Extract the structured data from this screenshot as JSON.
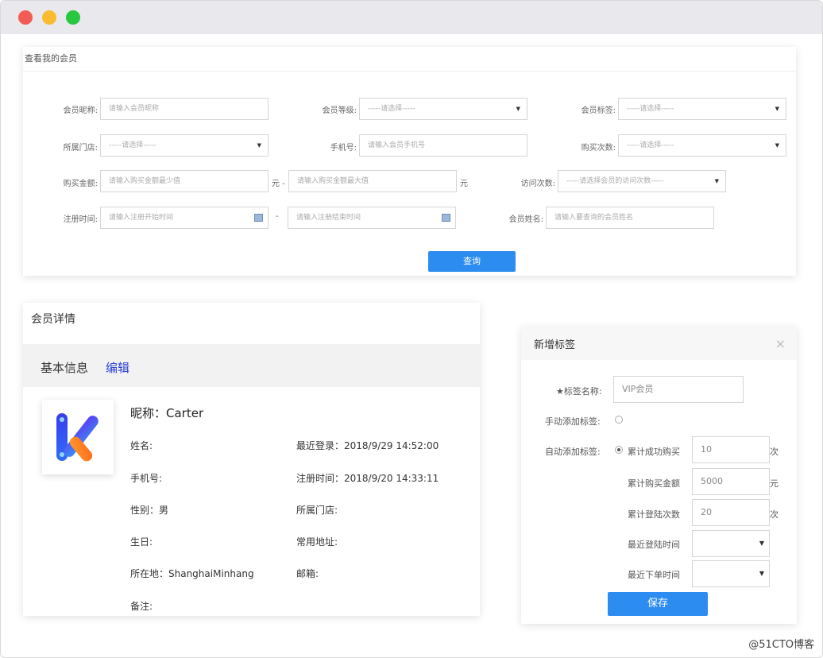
{
  "search": {
    "title": "查看我的会员",
    "nickname_label": "会员昵称:",
    "nickname_placeholder": "请输入会员昵称",
    "level_label": "会员等级:",
    "level_value": "-----请选择-----",
    "tag_label": "会员标签:",
    "tag_value": "-----请选择-----",
    "store_label": "所属门店:",
    "store_value": "-----请选择-----",
    "phone_label": "手机号:",
    "phone_placeholder": "请输入会员手机号",
    "purchase_count_label": "购买次数:",
    "purchase_count_value": "-----请选择-----",
    "amount_label": "购买金额:",
    "amount_min_placeholder": "请输入购买金额最少值",
    "amount_sep": "元 -",
    "amount_max_placeholder": "请输入购买金额最大值",
    "amount_unit": "元",
    "visit_label": "访问次数:",
    "visit_value": "-----请选择会员的访问次数-----",
    "reg_label": "注册时间:",
    "reg_start_placeholder": "请输入注册开始时间",
    "reg_sep": "-",
    "reg_end_placeholder": "请输入注册结束时间",
    "name_label": "会员姓名:",
    "name_placeholder": "请输入要查询的会员姓名",
    "query_button": "查询"
  },
  "detail": {
    "title": "会员详情",
    "basic_info": "基本信息",
    "edit": "编辑",
    "nickname": "昵称：Carter",
    "name": "姓名:",
    "last_login": "最近登录：2018/9/29 14:52:00",
    "phone": "手机号:",
    "reg_time": "注册时间：2018/9/20 14:33:11",
    "gender": "性别：男",
    "store": "所属门店:",
    "birthday": "生日:",
    "address": "常用地址:",
    "location": "所在地：ShanghaiMinhang",
    "email": "邮箱:",
    "remark": "备注:"
  },
  "tag_dialog": {
    "title": "新增标签",
    "close": "×",
    "name_label": "★标签名称:",
    "name_value": "VIP会员",
    "manual_label": "手动添加标签:",
    "auto_label": "自动添加标签:",
    "cond1_label": "累计成功购买",
    "cond1_value": "10",
    "cond1_unit": "次",
    "cond2_label": "累计购买金额",
    "cond2_value": "5000",
    "cond2_unit": "元",
    "cond3_label": "累计登陆次数",
    "cond3_value": "20",
    "cond3_unit": "次",
    "cond4_label": "最近登陆时间",
    "cond5_label": "最近下单时间",
    "save_button": "保存"
  },
  "watermark": "@51CTO博客",
  "colors": {
    "accent": "#2d8cf0",
    "edit_link": "#2a3fd6",
    "close_red": "#f25c57",
    "min_yellow": "#f9bb2f",
    "max_green": "#27c73f"
  }
}
